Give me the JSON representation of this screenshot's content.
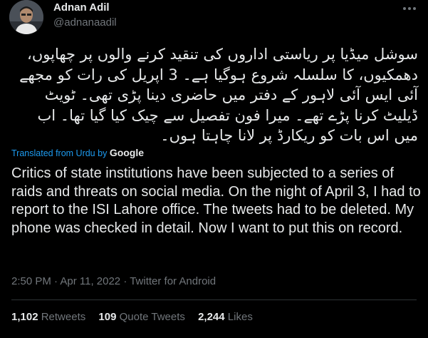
{
  "author": {
    "name": "Adnan Adil",
    "handle": "@adnanaadil"
  },
  "tweet": {
    "urdu_text": "سوشل میڈیا پر ریاستی اداروں کی تنقید کرنے والوں پر چھاپوں، دھمکیوں، کا سلسلہ شروع ہوگیا ہے۔ 3 اپریل کی رات کو مجھے آئی ایس آئی لاہور کے دفتر میں حاضری دینا پڑی تھی۔ ٹویٹ ڈیلیٹ کرنا پڑے تھے۔ میرا فون تفصیل سے چیک کیا گیا تھا۔ اب میں اس بات کو ریکارڈ پر لانا چاہتا ہوں۔",
    "translated_label": "Translated from Urdu",
    "translated_by": "by",
    "translator": "Google",
    "english_text": "Critics of state institutions have been subjected to a series of raids and threats on social media. On the night of April 3, I had to report to the ISI Lahore office. The tweets had to be deleted. My phone was checked in detail. Now I want to put this on record.",
    "timestamp": "2:50 PM · Apr 11, 2022 · Twitter for Android"
  },
  "stats": {
    "retweets_count": "1,102",
    "retweets_label": "Retweets",
    "quotes_count": "109",
    "quotes_label": "Quote Tweets",
    "likes_count": "2,244",
    "likes_label": "Likes"
  },
  "icons": {
    "more": "more-options-icon",
    "avatar": "avatar-photo"
  },
  "colors": {
    "background": "#000000",
    "text": "#e7e9ea",
    "secondary": "#71767b",
    "link": "#1d9bf0",
    "divider": "#2f3336"
  }
}
